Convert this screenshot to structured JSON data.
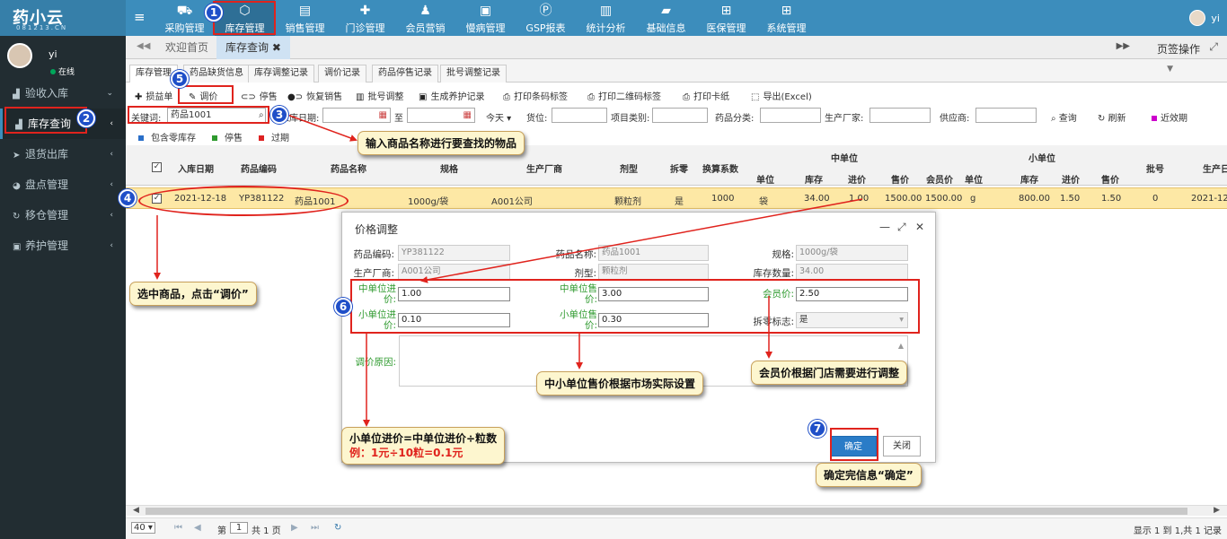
{
  "app": {
    "logo_text": "药小云",
    "logo_sub": "081213.CN"
  },
  "top_nav": [
    {
      "label": "采购管理",
      "icon": "cart-icon"
    },
    {
      "label": "库存管理",
      "icon": "cube-icon"
    },
    {
      "label": "销售管理",
      "icon": "register-icon"
    },
    {
      "label": "门诊管理",
      "icon": "medkit-icon"
    },
    {
      "label": "会员营销",
      "icon": "users-icon"
    },
    {
      "label": "慢病管理",
      "icon": "clipboard-icon"
    },
    {
      "label": "GSP报表",
      "icon": "gsp-icon"
    },
    {
      "label": "统计分析",
      "icon": "barchart-icon"
    },
    {
      "label": "基础信息",
      "icon": "book-icon"
    },
    {
      "label": "医保管理",
      "icon": "windows-icon"
    },
    {
      "label": "系统管理",
      "icon": "windows-icon"
    }
  ],
  "top_user": "yi",
  "sidebar": {
    "user_name": "yi",
    "status": "在线",
    "items": [
      {
        "label": "验收入库"
      },
      {
        "label": "库存查询"
      },
      {
        "label": "退货出库"
      },
      {
        "label": "盘点管理"
      },
      {
        "label": "移仓管理"
      },
      {
        "label": "养护管理"
      }
    ]
  },
  "tabbar": {
    "home": "欢迎首页",
    "current": "库存查询 ✖",
    "page_ops": "页签操作"
  },
  "subtabs": [
    "库存管理",
    "药品缺货信息",
    "库存调整记录",
    "调价记录",
    "药品停售记录",
    "批号调整记录"
  ],
  "toolbar": [
    "损益单",
    "调价",
    "停售",
    "恢复销售",
    "批号调整",
    "生成养护记录",
    "打印条码标签",
    "打印二维码标签",
    "打印卡纸",
    "导出(Excel)"
  ],
  "filters": {
    "keyword_label": "关键词:",
    "keyword_value": "药品1001",
    "date_label": "入库日期:",
    "to_label": "至",
    "today": "今天",
    "location": "货位:",
    "project": "项目类别:",
    "category": "药品分类:",
    "maker": "生产厂家:",
    "supplier": "供应商:",
    "query": "查询",
    "refresh": "刷新",
    "near": "近效期"
  },
  "legend": [
    {
      "label": "包含零库存",
      "color": "#2a6fc9"
    },
    {
      "label": "停售",
      "color": "#2e9a2e"
    },
    {
      "label": "过期",
      "color": "#d22"
    }
  ],
  "grid": {
    "headers": [
      "入库日期",
      "药品编码",
      "药品名称",
      "规格",
      "生产厂商",
      "剂型",
      "拆零",
      "换算系数"
    ],
    "mid_group": "中单位",
    "small_group": "小单位",
    "mid_cols": [
      "单位",
      "库存",
      "进价",
      "售价",
      "会员价"
    ],
    "small_cols": [
      "单位",
      "库存",
      "进价",
      "售价"
    ],
    "tail_cols": [
      "批号",
      "生产日"
    ],
    "row": [
      "2021-12-18",
      "YP381122",
      "药品1001",
      "1000g/袋",
      "A001公司",
      "颗粒剂",
      "是",
      "1000",
      "袋",
      "34.00",
      "1.00",
      "1500.00",
      "1500.00",
      "g",
      "800.00",
      "1.50",
      "1.50",
      "0",
      "2021-12"
    ]
  },
  "pager": {
    "size": "40",
    "page_label": "第",
    "page": "1",
    "total": "共 1 页",
    "summary": "显示 1 到 1,共 1 记录"
  },
  "dialog": {
    "title": "价格调整",
    "code_label": "药品编码:",
    "code": "YP381122",
    "name_label": "药品名称:",
    "name": "药品1001",
    "spec_label": "规格:",
    "spec": "1000g/袋",
    "maker_label": "生产厂商:",
    "maker": "A001公司",
    "form_label": "剂型:",
    "form": "颗粒剂",
    "stock_label": "库存数量:",
    "stock": "34.00",
    "mid_in_label": "中单位进价:",
    "mid_in": "1.00",
    "mid_sale_label": "中单位售价:",
    "mid_sale": "3.00",
    "member_label": "会员价:",
    "member": "2.50",
    "small_in_label": "小单位进价:",
    "small_in": "0.10",
    "small_sale_label": "小单位售价:",
    "small_sale": "0.30",
    "split_label": "拆零标志:",
    "split": "是",
    "reason_label": "调价原因:",
    "ok": "确定",
    "close": "关闭"
  },
  "annotations": {
    "c1": "1",
    "c2": "2",
    "c3": "3",
    "c4": "4",
    "c5": "5",
    "c6": "6",
    "c7": "7",
    "call_search": "输入商品名称进行要查找的物品",
    "call_select": "选中商品，点击“调价”",
    "call_sale": "中小单位售价根据市场实际设置",
    "call_member": "会员价根据门店需要进行调整",
    "call_formula": "小单位进价=中单位进价÷粒数",
    "call_example": "例：1元÷10粒=0.1元",
    "call_confirm": "确定完信息“确定”"
  }
}
